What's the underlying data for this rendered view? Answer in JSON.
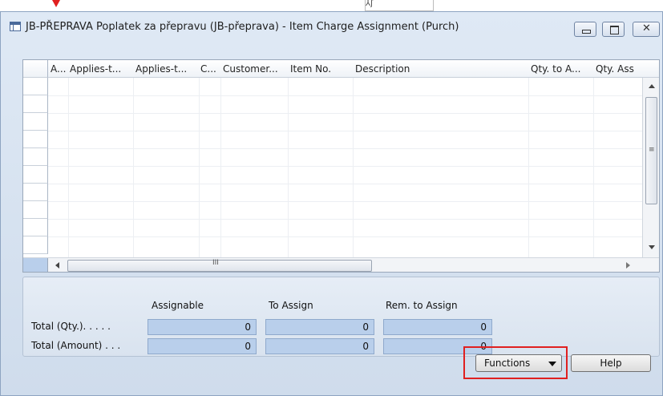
{
  "window": {
    "title": "JB-PŘEPRAVA Poplatek za přepravu (JB-přeprava) - Item Charge Assignment (Purch)",
    "close_glyph": "✕"
  },
  "cursor_tooltip": "⅄ʃ",
  "grid": {
    "columns": [
      "A...",
      "Applies-t...",
      "Applies-t...",
      "C...",
      "Customer...",
      "Item No.",
      "Description",
      "Qty. to A...",
      "Qty. Ass"
    ],
    "row_count": 10,
    "hscroll_glyph": "III",
    "vscroll_glyph": "≡"
  },
  "totals": {
    "headers": [
      "Assignable",
      "To Assign",
      "Rem. to Assign"
    ],
    "rows": [
      {
        "label": "Total (Qty.). . . . .",
        "values": [
          "0",
          "0",
          "0"
        ]
      },
      {
        "label": "Total (Amount) . . .",
        "values": [
          "0",
          "0",
          "0"
        ]
      }
    ]
  },
  "buttons": {
    "functions": "Functions",
    "help": "Help"
  },
  "colors": {
    "highlight": "#e02020",
    "field_bg": "#b9cfeb"
  }
}
